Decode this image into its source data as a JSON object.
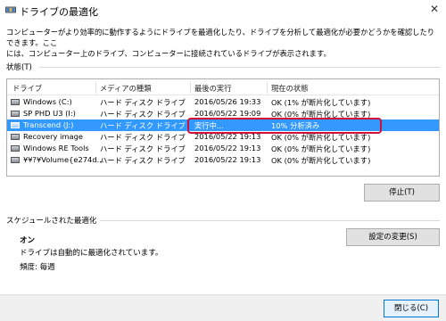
{
  "window": {
    "title": "ドライブの最適化"
  },
  "description": {
    "line1": "コンピューターがより効率的に動作するようにドライブを最適化したり、ドライブを分析して最適化が必要かどうかを確認したりできます。ここ",
    "line2": "には、コンピューター上のドライブ、コンピューターに接続されているドライブが表示されます。"
  },
  "status": {
    "label": "状態(T)",
    "columns": [
      "ドライブ",
      "メディアの種類",
      "最後の実行",
      "現在の状態"
    ],
    "rows": [
      {
        "drive": "Windows (C:)",
        "media": "ハード ディスク ドライブ",
        "last_run": "2016/05/26 19:33",
        "state": "OK (1% が断片化しています)"
      },
      {
        "drive": "SP PHD U3 (I:)",
        "media": "ハード ディスク ドライブ",
        "last_run": "2016/05/22 19:09",
        "state": "OK (0% が断片化しています)"
      },
      {
        "drive": "Transcend (J:)",
        "media": "ハード ディスク ドライブ",
        "last_run": "実行中...",
        "state": "10% 分析済み",
        "selected": true
      },
      {
        "drive": "Recovery image",
        "media": "ハード ディスク ドライブ",
        "last_run": "2016/05/22 19:13",
        "state": "OK (0% が断片化しています)"
      },
      {
        "drive": "Windows RE Tools",
        "media": "ハード ディスク ドライブ",
        "last_run": "2016/05/22 19:13",
        "state": "OK (0% が断片化しています)"
      },
      {
        "drive": "¥¥?¥Volume{e274d...",
        "media": "ハード ディスク ドライブ",
        "last_run": "2016/05/22 19:13",
        "state": "OK (0% が断片化しています)"
      }
    ],
    "stop_button": "停止(T)"
  },
  "schedule": {
    "label": "スケジュールされた最適化",
    "status": "オン",
    "auto_text": "ドライブは自動的に最適化されています。",
    "frequency": "頻度: 毎週",
    "change_button": "設定の変更(S)"
  },
  "footer": {
    "close_button": "閉じる(C)"
  }
}
